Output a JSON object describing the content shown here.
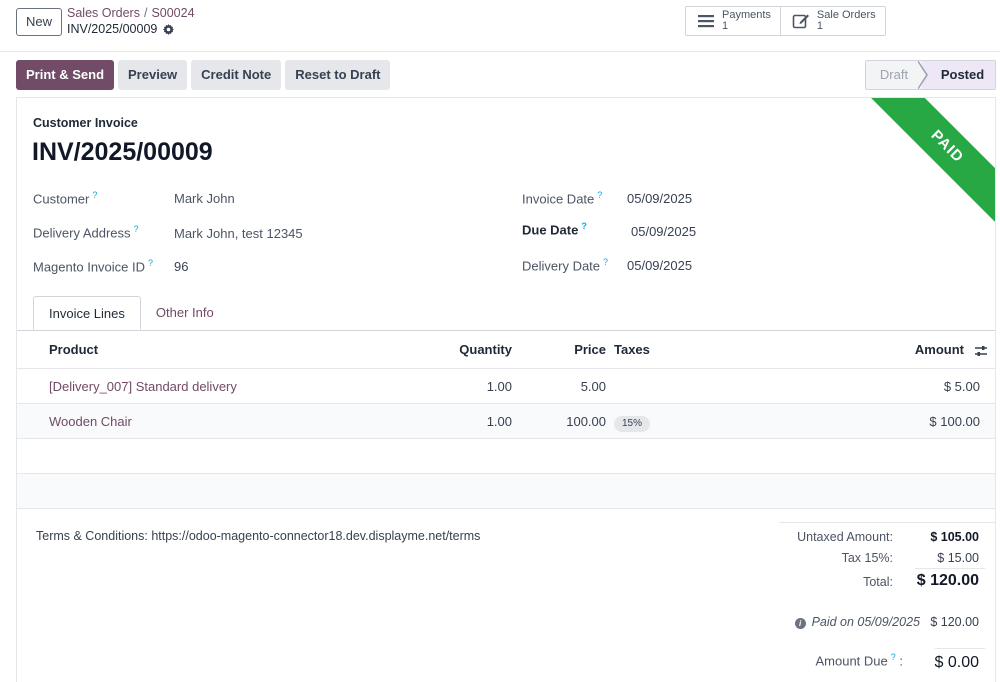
{
  "control_panel": {
    "new_label": "New",
    "breadcrumb": [
      "Sales Orders",
      "S00024"
    ],
    "breadcrumb_sep": "/",
    "record_name": "INV/2025/00009",
    "smart_buttons": [
      {
        "label": "Payments",
        "count": "1",
        "icon": "list-icon"
      },
      {
        "label": "Sale Orders",
        "count": "1",
        "icon": "edit-icon"
      }
    ]
  },
  "actions": {
    "print_send": "Print & Send",
    "preview": "Preview",
    "credit_note": "Credit Note",
    "reset_draft": "Reset to Draft"
  },
  "status": {
    "stages": [
      "Draft",
      "Posted"
    ],
    "current": "Posted"
  },
  "invoice": {
    "type_label": "Customer Invoice",
    "name": "INV/2025/00009",
    "ribbon": "PAID",
    "fields_left": [
      {
        "label": "Customer",
        "value": "Mark John"
      },
      {
        "label": "Delivery Address",
        "value": "Mark John, test 12345"
      },
      {
        "label": "Magento Invoice ID",
        "value": "96"
      }
    ],
    "fields_right": [
      {
        "label": "Invoice Date",
        "value": "05/09/2025"
      },
      {
        "label": "Due Date",
        "value": "05/09/2025"
      },
      {
        "label": "Delivery Date",
        "value": "05/09/2025"
      }
    ],
    "help_mark": "?"
  },
  "tabs": [
    "Invoice Lines",
    "Other Info"
  ],
  "lines": {
    "headers": {
      "product": "Product",
      "quantity": "Quantity",
      "price": "Price",
      "taxes": "Taxes",
      "amount": "Amount"
    },
    "rows": [
      {
        "product": "[Delivery_007] Standard delivery",
        "quantity": "1.00",
        "price": "5.00",
        "taxes": "",
        "amount": "$ 5.00"
      },
      {
        "product": "Wooden Chair",
        "quantity": "1.00",
        "price": "100.00",
        "taxes": "15%",
        "amount": "$ 100.00"
      }
    ]
  },
  "footer": {
    "terms": "Terms & Conditions: https://odoo-magento-connector18.dev.displayme.net/terms",
    "untaxed_label": "Untaxed Amount:",
    "untaxed_value": "$ 105.00",
    "tax_label": "Tax 15%:",
    "tax_value": "$ 15.00",
    "total_label": "Total:",
    "total_value": "$ 120.00",
    "paid_label": "Paid on 05/09/2025",
    "paid_value": "$ 120.00",
    "due_label": "Amount Due",
    "due_value": "$ 0.00"
  },
  "colors": {
    "brand": "#714b67",
    "paid_ribbon": "#28a745"
  }
}
